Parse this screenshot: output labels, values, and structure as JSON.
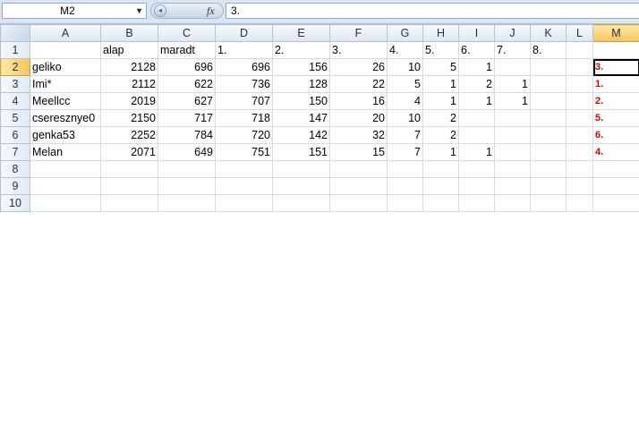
{
  "formula_bar": {
    "name_box": "M2",
    "fx_label": "fx",
    "formula_value": "3."
  },
  "columns": [
    "A",
    "B",
    "C",
    "D",
    "E",
    "F",
    "G",
    "H",
    "I",
    "J",
    "K",
    "L",
    "M"
  ],
  "row_numbers": [
    "1",
    "2",
    "3",
    "4",
    "5",
    "6",
    "7",
    "8",
    "9",
    "10"
  ],
  "rows": [
    [
      "",
      "alap",
      "maradt",
      "1.",
      "2.",
      "3.",
      "4.",
      "5.",
      "6.",
      "7.",
      "8.",
      "",
      ""
    ],
    [
      "geliko",
      "2128",
      "696",
      "696",
      "156",
      "26",
      "10",
      "5",
      "1",
      "",
      "",
      "",
      "3."
    ],
    [
      "Imi*",
      "2112",
      "622",
      "736",
      "128",
      "22",
      "5",
      "1",
      "2",
      "1",
      "",
      "",
      "1."
    ],
    [
      "Meellcc",
      "2019",
      "627",
      "707",
      "150",
      "16",
      "4",
      "1",
      "1",
      "1",
      "",
      "",
      "2."
    ],
    [
      "cseresznye0",
      "2150",
      "717",
      "718",
      "147",
      "20",
      "10",
      "2",
      "",
      "",
      "",
      "",
      "5."
    ],
    [
      "genka53",
      "2252",
      "784",
      "720",
      "142",
      "32",
      "7",
      "2",
      "",
      "",
      "",
      "",
      "6."
    ],
    [
      "Melan",
      "2071",
      "649",
      "751",
      "151",
      "15",
      "7",
      "1",
      "1",
      "",
      "",
      "",
      "4."
    ],
    [
      "",
      "",
      "",
      "",
      "",
      "",
      "",
      "",
      "",
      "",
      "",
      "",
      ""
    ],
    [
      "",
      "",
      "",
      "",
      "",
      "",
      "",
      "",
      "",
      "",
      "",
      "",
      ""
    ],
    [
      "",
      "",
      "",
      "",
      "",
      "",
      "",
      "",
      "",
      "",
      "",
      "",
      ""
    ]
  ],
  "active_cell": "M2",
  "colors": {
    "rank_text": "#e00000",
    "header_bg": "#dde6f2",
    "selected_header": "#f6c45c"
  }
}
